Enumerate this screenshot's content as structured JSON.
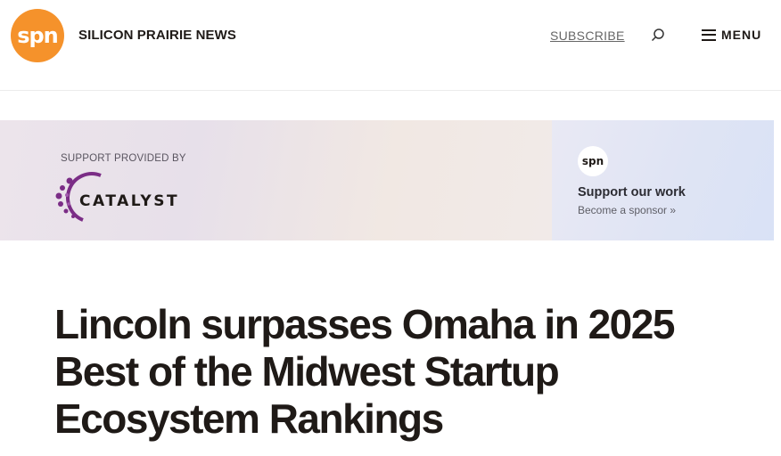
{
  "header": {
    "logo_text": "spn",
    "site_name": "SILICON PRAIRIE NEWS",
    "subscribe_label": "SUBSCRIBE",
    "search_icon": "search-icon",
    "menu_label": "MENU",
    "brand_color": "#f5922b"
  },
  "banner": {
    "support_label": "SUPPORT PROVIDED BY",
    "sponsor_name": "CATALYST",
    "sponsor_color": "#7b2d86",
    "cta_logo_text": "spn",
    "cta_title": "Support our work",
    "cta_link": "Become a sponsor »"
  },
  "article": {
    "headline": "Lincoln surpasses Omaha in 2025 Best of the Midwest Startup Ecosystem Rankings"
  }
}
